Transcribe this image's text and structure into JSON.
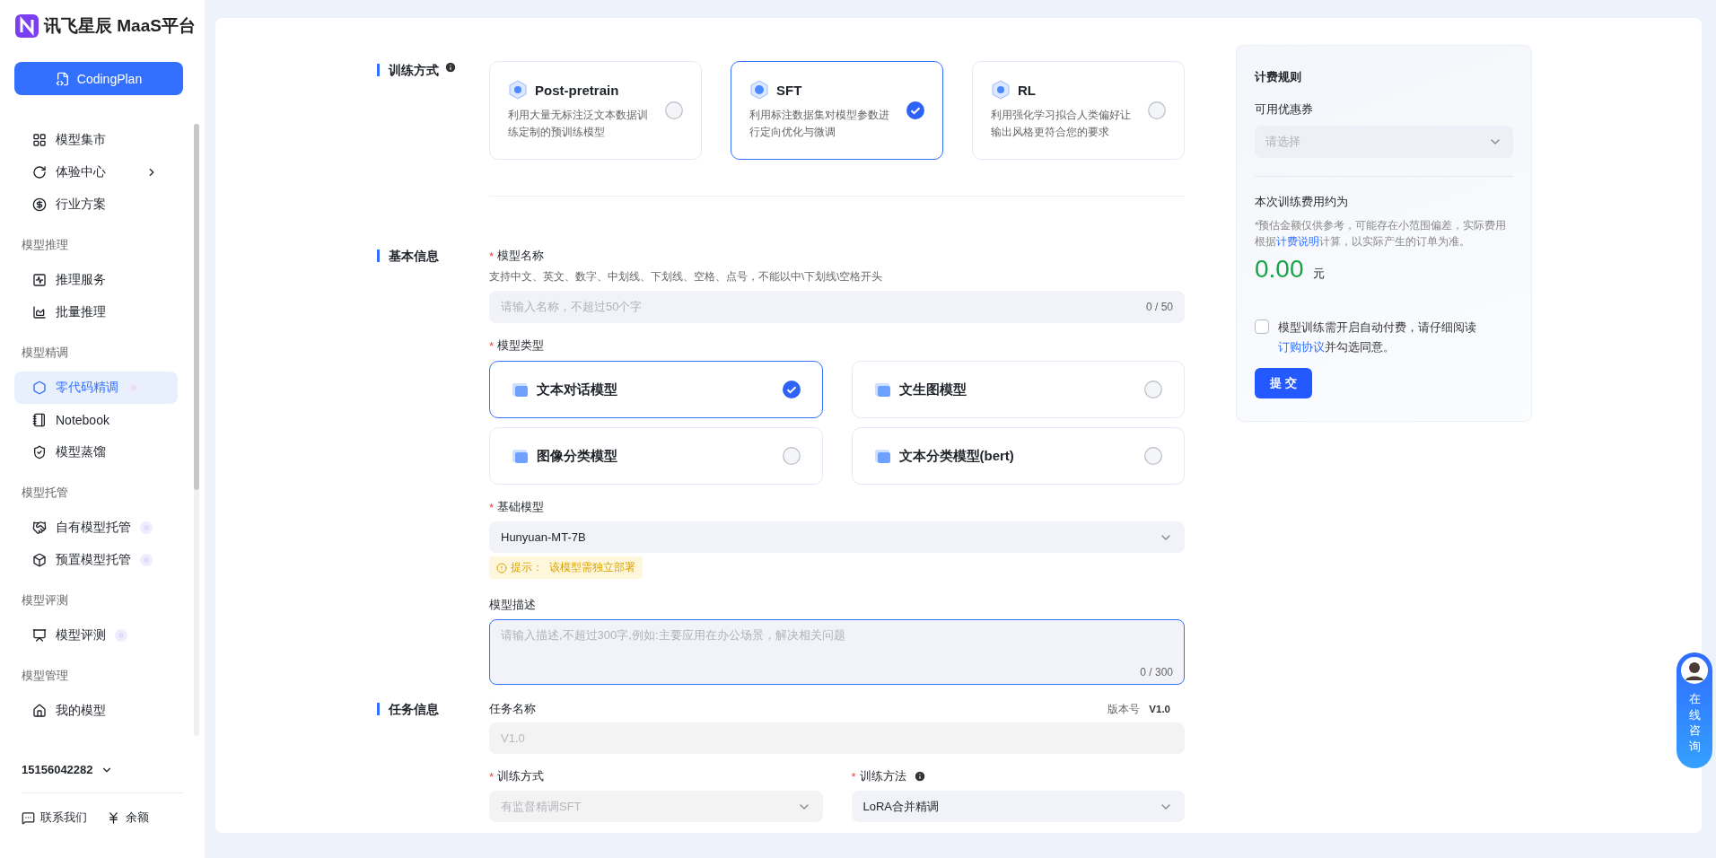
{
  "brand": {
    "name": "讯飞星辰 MaaS平台"
  },
  "sidebar": {
    "primary_button": "CodingPlan",
    "items": [
      {
        "kind": "item",
        "label": "模型集市",
        "selected": false,
        "submenu": false,
        "badge": false
      },
      {
        "kind": "item",
        "label": "体验中心",
        "selected": false,
        "submenu": true,
        "badge": false
      },
      {
        "kind": "item",
        "label": "行业方案",
        "selected": false,
        "submenu": false,
        "badge": false
      },
      {
        "kind": "group",
        "label": "模型推理"
      },
      {
        "kind": "item",
        "label": "推理服务",
        "selected": false,
        "submenu": false,
        "badge": false
      },
      {
        "kind": "item",
        "label": "批量推理",
        "selected": false,
        "submenu": false,
        "badge": false
      },
      {
        "kind": "group",
        "label": "模型精调"
      },
      {
        "kind": "item",
        "label": "零代码精调",
        "selected": true,
        "submenu": false,
        "badge": true
      },
      {
        "kind": "item",
        "label": "Notebook",
        "selected": false,
        "submenu": false,
        "badge": false
      },
      {
        "kind": "item",
        "label": "模型蒸馏",
        "selected": false,
        "submenu": false,
        "badge": false
      },
      {
        "kind": "group",
        "label": "模型托管"
      },
      {
        "kind": "item",
        "label": "自有模型托管",
        "selected": false,
        "submenu": false,
        "badge": true
      },
      {
        "kind": "item",
        "label": "预置模型托管",
        "selected": false,
        "submenu": false,
        "badge": true
      },
      {
        "kind": "group",
        "label": "模型评测"
      },
      {
        "kind": "item",
        "label": "模型评测",
        "selected": false,
        "submenu": false,
        "badge": true
      },
      {
        "kind": "group",
        "label": "模型管理"
      },
      {
        "kind": "item",
        "label": "我的模型",
        "selected": false,
        "submenu": false,
        "badge": false
      }
    ],
    "account": "15156042282",
    "footer_links": [
      "联系我们",
      "余额"
    ]
  },
  "training_type": {
    "label": "训练方式",
    "options": [
      {
        "title": "Post-pretrain",
        "description": "利用大量无标注泛文本数据训练定制的预训练模型",
        "selected": false
      },
      {
        "title": "SFT",
        "description": "利用标注数据集对模型参数进行定向优化与微调",
        "selected": true
      },
      {
        "title": "RL",
        "description": "利用强化学习拟合人类偏好让输出风格更符合您的要求",
        "selected": false
      }
    ]
  },
  "basic_info": {
    "label": "基本信息",
    "model_name": {
      "marker": "*",
      "label": "模型名称",
      "hint": "支持中文、英文、数字、中划线、下划线、空格、点号，不能以中\\下划线\\空格开头",
      "placeholder": "请输入名称，不超过50个字",
      "counter": "0 / 50"
    },
    "model_type": {
      "marker": "*",
      "label": "模型类型",
      "options": [
        {
          "label": "文本对话模型",
          "selected": true
        },
        {
          "label": "文生图模型",
          "selected": false
        },
        {
          "label": "图像分类模型",
          "selected": false
        },
        {
          "label": "文本分类模型(bert)",
          "selected": false
        }
      ]
    },
    "base_model": {
      "marker": "*",
      "label": "基础模型",
      "value": "Hunyuan-MT-7B",
      "tip": "提示：  该模型需独立部署"
    },
    "description": {
      "label": "模型描述",
      "placeholder": "请输入描述,不超过300字,例如:主要应用在办公场景，解决相关问题",
      "counter": "0 / 300",
      "focused": true
    }
  },
  "task_info": {
    "label": "任务信息",
    "task_name": {
      "label": "任务名称",
      "version_label": "版本号",
      "version": "V1.0",
      "value": "V1.0",
      "disabled": true
    },
    "train_mode": {
      "marker": "*",
      "label": "训练方式",
      "value": "有监督精调SFT",
      "disabled": true
    },
    "train_method": {
      "marker": "*",
      "label": "训练方法",
      "value": "LoRA合并精调",
      "disabled": false
    }
  },
  "billing": {
    "title": "计费规则",
    "coupon_label": "可用优惠券",
    "coupon_placeholder": "请选择",
    "cost_label": "本次训练费用约为",
    "note_before": "*预估金额仅供参考，可能存在小范围偏差，实际费用根据",
    "note_link": "计费说明",
    "note_after": "计算，以实际产生的订单为准。",
    "amount": "0.00",
    "currency": "元",
    "agreement": {
      "checked": false,
      "text": "模型训练需开启自动付费，请仔细阅读",
      "link": "订购协议",
      "after": "并勾选同意。"
    },
    "submit": "提 交"
  },
  "consult": {
    "label": "在线咨询"
  }
}
